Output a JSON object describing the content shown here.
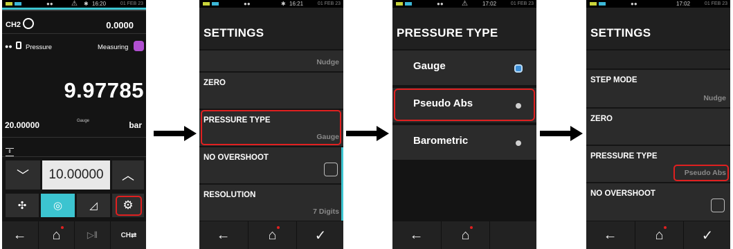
{
  "screens": [
    {
      "status": {
        "time": "16:20",
        "date": "01 FEB 23"
      },
      "channel": "CH2",
      "channel_value": "0.0000",
      "mode": "Pressure",
      "state": "Measuring",
      "reading": "9.97785",
      "range": "20.00000",
      "pressure_type": "Gauge",
      "unit": "bar",
      "setpoint": "10.00000"
    },
    {
      "status": {
        "time": "16:21",
        "date": "01 FEB 23"
      },
      "title": "SETTINGS",
      "top_value": "Nudge",
      "rows": [
        {
          "label": "ZERO",
          "value": ""
        },
        {
          "label": "PRESSURE TYPE",
          "value": "Gauge"
        },
        {
          "label": "NO OVERSHOOT",
          "value": ""
        },
        {
          "label": "RESOLUTION",
          "value": "7 Digits"
        }
      ]
    },
    {
      "status": {
        "time": "17:02",
        "date": "01 FEB 23"
      },
      "title": "PRESSURE TYPE",
      "options": [
        {
          "label": "Gauge",
          "selected": true
        },
        {
          "label": "Pseudo Abs",
          "selected": false
        },
        {
          "label": "Barometric",
          "selected": false
        }
      ]
    },
    {
      "status": {
        "time": "17:02",
        "date": "01 FEB 23"
      },
      "title": "SETTINGS",
      "rows": [
        {
          "label": "STEP MODE",
          "value": "Nudge"
        },
        {
          "label": "ZERO",
          "value": ""
        },
        {
          "label": "PRESSURE TYPE",
          "value": "Pseudo Abs"
        },
        {
          "label": "NO OVERSHOOT",
          "value": ""
        }
      ]
    }
  ],
  "icons": {
    "back": "back-arrow-icon",
    "home": "home-icon",
    "play_pause": "play-pause-icon",
    "channel": "channel-icon",
    "confirm": "checkmark-icon",
    "settings": "gear-icon"
  },
  "colors": {
    "accent": "#3cc4d0",
    "highlight": "#e02020",
    "measuring_badge": "#b04fd0"
  }
}
